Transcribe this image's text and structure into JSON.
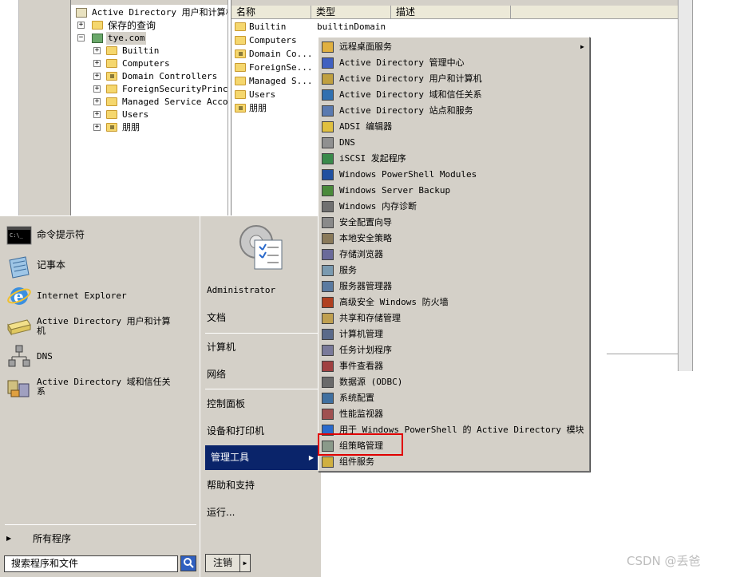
{
  "aduc": {
    "tree": {
      "root": "Active Directory 用户和计算机",
      "items": [
        {
          "label": "保存的查询"
        },
        {
          "label": "tye.com"
        },
        {
          "label": "Builtin"
        },
        {
          "label": "Computers"
        },
        {
          "label": "Domain Controllers"
        },
        {
          "label": "ForeignSecurityPrincip"
        },
        {
          "label": "Managed Service Accour"
        },
        {
          "label": "Users"
        },
        {
          "label": "朋朋"
        }
      ]
    },
    "list": {
      "columns": [
        "名称",
        "类型",
        "描述"
      ],
      "rows": [
        {
          "name": "Builtin",
          "type": "builtinDomain"
        },
        {
          "name": "Computers",
          "type": ""
        },
        {
          "name": "Domain Co...",
          "type": ""
        },
        {
          "name": "ForeignSe...",
          "type": ""
        },
        {
          "name": "Managed S...",
          "type": ""
        },
        {
          "name": "Users",
          "type": ""
        },
        {
          "name": "朋朋",
          "type": ""
        }
      ]
    }
  },
  "start_menu": {
    "pinned": [
      {
        "label": "命令提示符",
        "icon": "cmd-icon"
      },
      {
        "label": "记事本",
        "icon": "notepad-icon"
      },
      {
        "label": "Internet Explorer",
        "icon": "ie-icon"
      },
      {
        "label": "Active Directory 用户和计算机",
        "icon": "aduc-icon"
      },
      {
        "label": "DNS",
        "icon": "dns-icon"
      },
      {
        "label": "Active Directory 域和信任关系",
        "icon": "ad-domains-icon"
      }
    ],
    "all_programs": "所有程序",
    "search_placeholder": "搜索程序和文件",
    "logoff": "注销",
    "right": {
      "user": "Administrator",
      "documents": "文档",
      "computer": "计算机",
      "network": "网络",
      "control_panel": "控制面板",
      "devices": "设备和打印机",
      "admin_tools": "管理工具",
      "help": "帮助和支持",
      "run": "运行..."
    }
  },
  "admin_tools_menu": {
    "items": [
      {
        "label": "远程桌面服务",
        "icon": "folder-icon",
        "submenu": true
      },
      {
        "label": "Active Directory 管理中心",
        "icon": "ad-admin-center-icon"
      },
      {
        "label": "Active Directory 用户和计算机",
        "icon": "aduc-icon"
      },
      {
        "label": "Active Directory 域和信任关系",
        "icon": "ad-domains-icon"
      },
      {
        "label": "Active Directory 站点和服务",
        "icon": "ad-sites-icon"
      },
      {
        "label": "ADSI 编辑器",
        "icon": "adsi-icon"
      },
      {
        "label": "DNS",
        "icon": "dns-icon"
      },
      {
        "label": "iSCSI 发起程序",
        "icon": "iscsi-icon"
      },
      {
        "label": "Windows PowerShell Modules",
        "icon": "powershell-icon"
      },
      {
        "label": "Windows Server Backup",
        "icon": "backup-icon"
      },
      {
        "label": "Windows 内存诊断",
        "icon": "memory-icon"
      },
      {
        "label": "安全配置向导",
        "icon": "security-wizard-icon"
      },
      {
        "label": "本地安全策略",
        "icon": "local-policy-icon"
      },
      {
        "label": "存储浏览器",
        "icon": "storage-icon"
      },
      {
        "label": "服务",
        "icon": "services-icon"
      },
      {
        "label": "服务器管理器",
        "icon": "server-manager-icon"
      },
      {
        "label": "高级安全 Windows 防火墙",
        "icon": "firewall-icon"
      },
      {
        "label": "共享和存储管理",
        "icon": "share-icon"
      },
      {
        "label": "计算机管理",
        "icon": "computer-mgmt-icon"
      },
      {
        "label": "任务计划程序",
        "icon": "task-scheduler-icon"
      },
      {
        "label": "事件查看器",
        "icon": "event-viewer-icon"
      },
      {
        "label": "数据源 (ODBC)",
        "icon": "odbc-icon"
      },
      {
        "label": "系统配置",
        "icon": "msconfig-icon"
      },
      {
        "label": "性能监视器",
        "icon": "perfmon-icon"
      },
      {
        "label": "用于 Windows PowerShell 的 Active Directory 模块",
        "icon": "ad-powershell-icon"
      },
      {
        "label": "组策略管理",
        "icon": "gpo-icon"
      },
      {
        "label": "组件服务",
        "icon": "component-services-icon"
      }
    ]
  },
  "watermark": "CSDN @丢爸",
  "colors": {
    "menu_bg": "#d4d0c8",
    "selection": "#0a246a",
    "highlight_border": "#e00000"
  }
}
